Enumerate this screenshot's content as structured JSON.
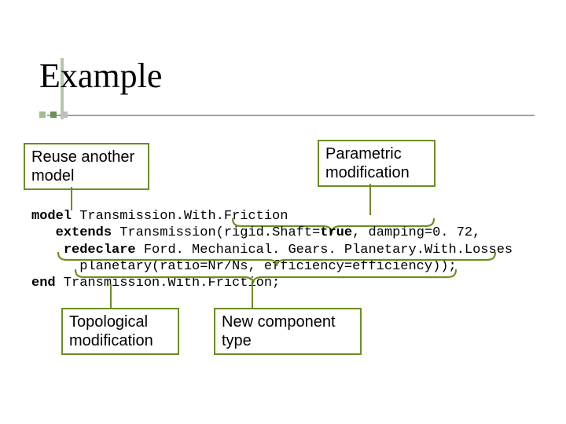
{
  "title": "Example",
  "labels": {
    "reuse": "Reuse another\nmodel",
    "parametric": "Parametric\nmodification",
    "topological": "Topological\nmodification",
    "newcomp": "New component\ntype"
  },
  "code": {
    "kw_model": "model",
    "name": " Transmission.With.Friction",
    "kw_extends": "extends",
    "extends_rest": " Transmission(rigid.Shaft=",
    "kw_true": "true",
    "extends_tail": ", damping=0. 72,",
    "kw_redeclare": "redeclare",
    "redeclare_rest": " Ford. Mechanical. Gears. Planetary.With.Losses",
    "line4": "      planetary(ratio=Nr/Ns, efficiency=efficiency));",
    "kw_end": "end",
    "end_rest": " Transmission.With.Friction;"
  }
}
